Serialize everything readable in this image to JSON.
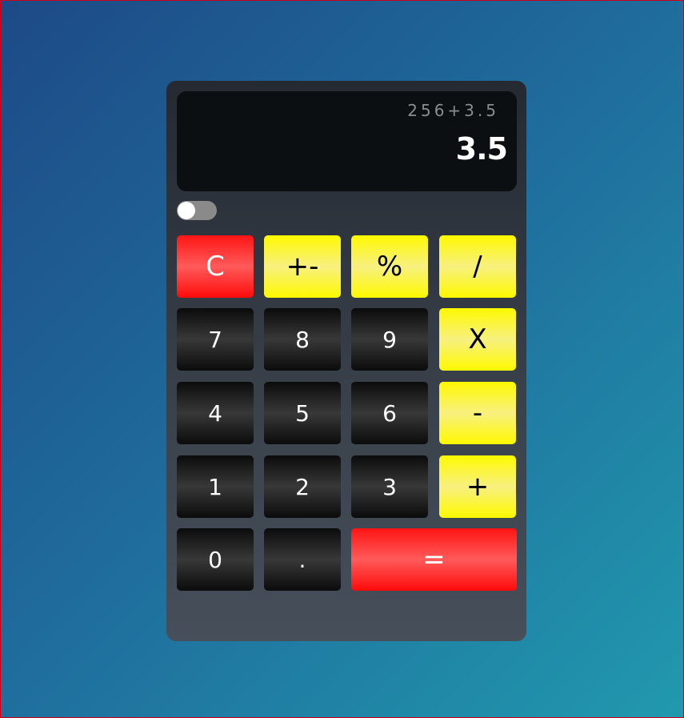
{
  "display": {
    "expression": "256+3.5",
    "result": "3.5"
  },
  "theme_toggle": {
    "state": "off"
  },
  "keys": {
    "clear": "C",
    "plus_minus": "+-",
    "percent": "%",
    "divide": "/",
    "seven": "7",
    "eight": "8",
    "nine": "9",
    "multiply": "X",
    "four": "4",
    "five": "5",
    "six": "6",
    "minus": "-",
    "one": "1",
    "two": "2",
    "three": "3",
    "plus": "+",
    "zero": "0",
    "decimal": ".",
    "equals": "="
  },
  "colors": {
    "operator": "#fff900",
    "clear_equals": "#ff1414",
    "digit": "#1a1a1a"
  }
}
